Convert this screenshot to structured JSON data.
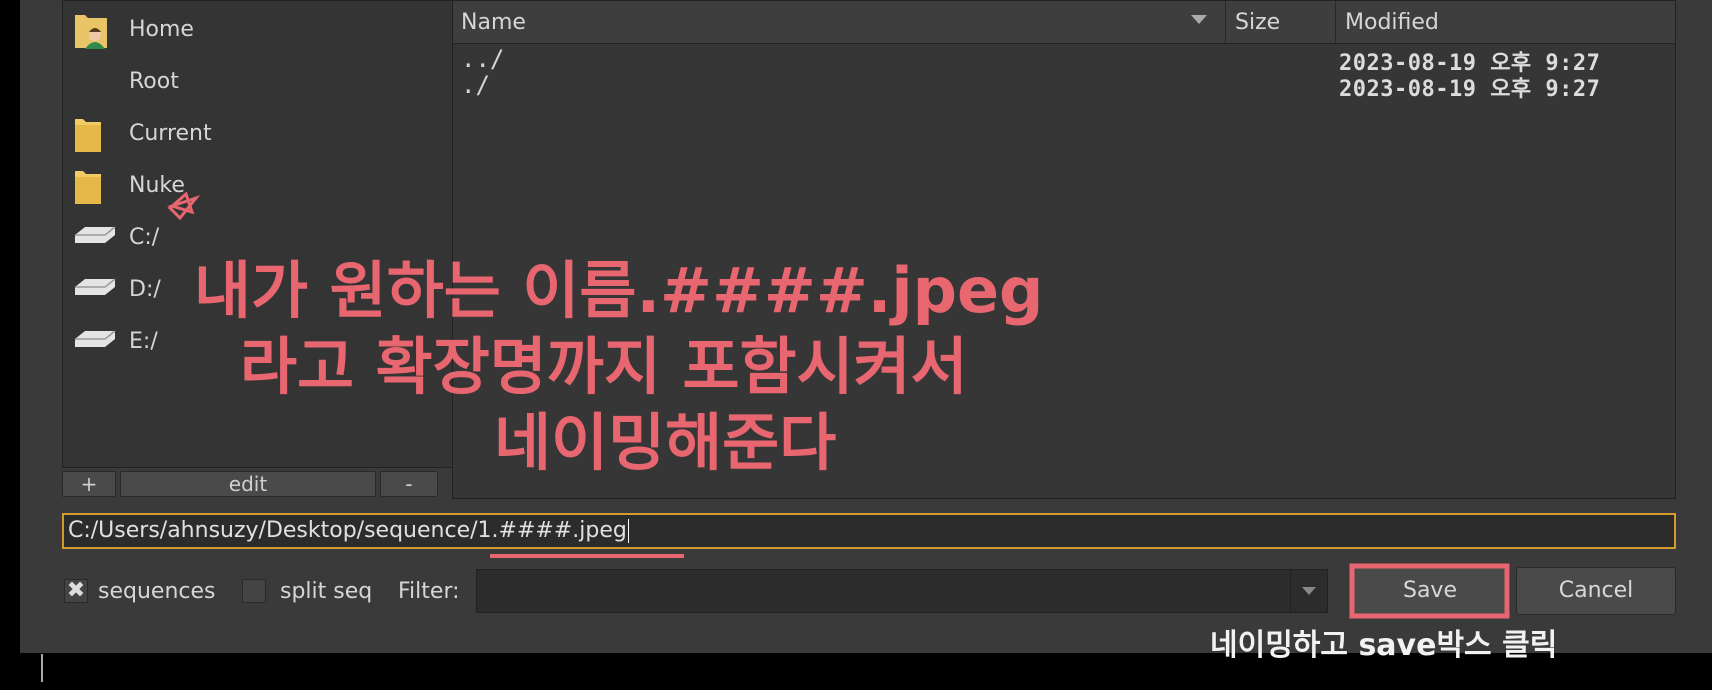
{
  "sidebar": {
    "items": [
      {
        "label": "Home",
        "icon": "home-folder-icon"
      },
      {
        "label": "Root",
        "icon": ""
      },
      {
        "label": "Current",
        "icon": "folder-icon"
      },
      {
        "label": "Nuke",
        "icon": "folder-icon"
      },
      {
        "label": "C:/",
        "icon": "drive-icon"
      },
      {
        "label": "D:/",
        "icon": "drive-icon"
      },
      {
        "label": "E:/",
        "icon": "drive-icon"
      }
    ],
    "buttons": {
      "add": "+",
      "edit": "edit",
      "remove": "-"
    }
  },
  "file_list": {
    "columns": {
      "name": "Name",
      "size": "Size",
      "modified": "Modified"
    },
    "rows": [
      {
        "name": "../",
        "size": "",
        "modified": "2023-08-19 오후 9:27"
      },
      {
        "name": "./",
        "size": "",
        "modified": "2023-08-19 오후 9:27"
      }
    ]
  },
  "path": {
    "value": "C:/Users/ahnsuzy/Desktop/sequence/1.####.jpeg"
  },
  "options": {
    "sequences_label": "sequences",
    "sequences_checked": true,
    "split_seq_label": "split seq",
    "split_seq_checked": false,
    "filter_label": "Filter:",
    "filter_value": ""
  },
  "buttons": {
    "save": "Save",
    "cancel": "Cancel"
  },
  "annotations": {
    "line1": "내가 원하는 이름.####.jpeg",
    "line2": "라고 확장명까지 포함시켜서",
    "line3": "네이밍해준다",
    "save_note": "네이밍하고 save박스 클릭",
    "star_mark": "☆"
  },
  "colors": {
    "annotation": "#e8666f",
    "focus_border": "#d49a2e",
    "background": "#3a3a3a"
  }
}
